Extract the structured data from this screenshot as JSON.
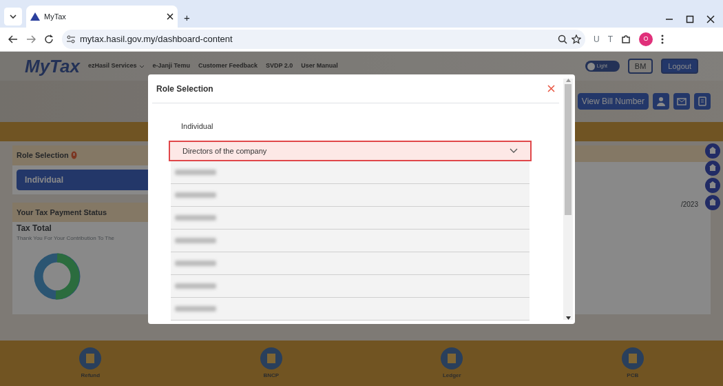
{
  "browser": {
    "tabs": [
      {
        "title": "MyTax",
        "selected": true
      }
    ],
    "new_tab": "+",
    "url": "mytax.hasil.gov.my/dashboard-content",
    "extensions": [
      "U",
      "T"
    ],
    "profile": "O"
  },
  "header": {
    "logo": "MyTax",
    "nav": [
      {
        "label": "ezHasil Services",
        "kind": "dropdown"
      },
      {
        "label": "e-Janji Temu",
        "kind": "link"
      },
      {
        "label": "Customer Feedback",
        "kind": "link"
      },
      {
        "label": "SVDP 2.0",
        "kind": "link"
      },
      {
        "label": "User Manual",
        "kind": "link"
      }
    ],
    "theme_toggle": {
      "label": "Light",
      "on": false
    },
    "buttons": [
      "BM",
      "Logout"
    ],
    "bill_button": "View Bill Number"
  },
  "role_panel": {
    "title": "Role Selection",
    "role": "Individual"
  },
  "tax_status": {
    "title": "Your Tax Payment Status",
    "heading": "Tax Total",
    "note": "Thank You For Your Contribution To The"
  },
  "right_panel": {
    "date_fragment": "/2023"
  },
  "bottom_nav": [
    "Refund",
    "BNCP",
    "Ledger",
    "PCB"
  ],
  "modal": {
    "title": "Role Selection",
    "options": [
      {
        "label": "Individual",
        "selected": false,
        "expanded": false
      },
      {
        "label": "Directors of the company",
        "selected": true,
        "expanded": true
      }
    ],
    "redacted_rows": [
      {
        "kind": "redacted"
      },
      {
        "kind": "redacted"
      },
      {
        "kind": "redacted"
      },
      {
        "kind": "redacted"
      },
      {
        "kind": "redacted"
      },
      {
        "kind": "redacted"
      },
      {
        "kind": "redacted"
      }
    ]
  }
}
